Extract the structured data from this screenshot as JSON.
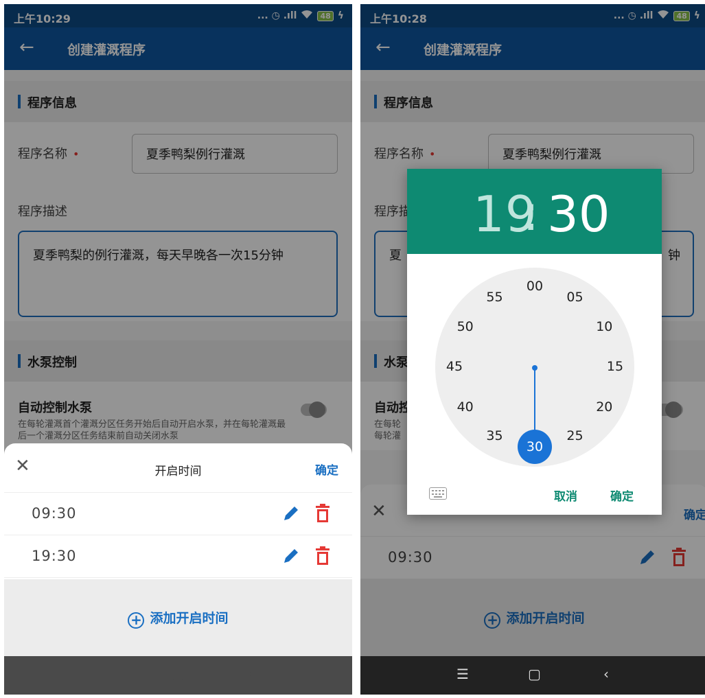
{
  "left": {
    "status_time": "上午10:29",
    "status_icons": "... ◷ .ıll ",
    "battery": "48",
    "app_title": "创建灌溉程序",
    "section_program": "程序信息",
    "name_label": "程序名称",
    "name_required": "•",
    "name_value": "夏季鸭梨例行灌溉",
    "desc_label": "程序描述",
    "desc_value": "夏季鸭梨的例行灌溉，每天早晚各一次15分钟",
    "section_pump": "水泵控制",
    "pump_title": "自动控制水泵",
    "pump_desc": "在每轮灌溉首个灌溉分区任务开始后自动开启水泵，并在每轮灌溉最后一个灌溉分区任务结束前自动关闭水泵",
    "sheet_title": "开启时间",
    "sheet_confirm": "确定",
    "times": [
      "09:30",
      "19:30"
    ],
    "add_time": "添加开启时间"
  },
  "right": {
    "status_time": "上午10:28",
    "status_icons": "... ◷ .ıll ",
    "battery": "48",
    "app_title": "创建灌溉程序",
    "section_program": "程序信息",
    "name_label": "程序名称",
    "name_required": "•",
    "name_value": "夏季鸭梨例行灌溉",
    "desc_label_partial": "程序描",
    "desc_value_partial": "夏",
    "desc_value_tail": "钟",
    "section_pump_partial": "水泵",
    "pump_title_partial": "自动控",
    "pump_desc_partial_1": "在每轮",
    "pump_desc_partial_2": "每轮灌",
    "sheet_confirm": "确定",
    "times": [
      "09:30"
    ],
    "add_time": "添加开启时间",
    "picker": {
      "hour": "19",
      "colon": ":",
      "minute": "30",
      "selected_minute": "30",
      "dial": [
        "00",
        "05",
        "10",
        "15",
        "20",
        "25",
        "35",
        "40",
        "45",
        "50",
        "55"
      ],
      "cancel": "取消",
      "confirm": "确定"
    }
  },
  "nav": {
    "menu": "☰",
    "home": "▢",
    "back": "‹"
  },
  "colors": {
    "primary": "#0f56a0",
    "accent_blue": "#1a6fc2",
    "danger": "#e53935",
    "picker_green": "#0e8a72"
  }
}
